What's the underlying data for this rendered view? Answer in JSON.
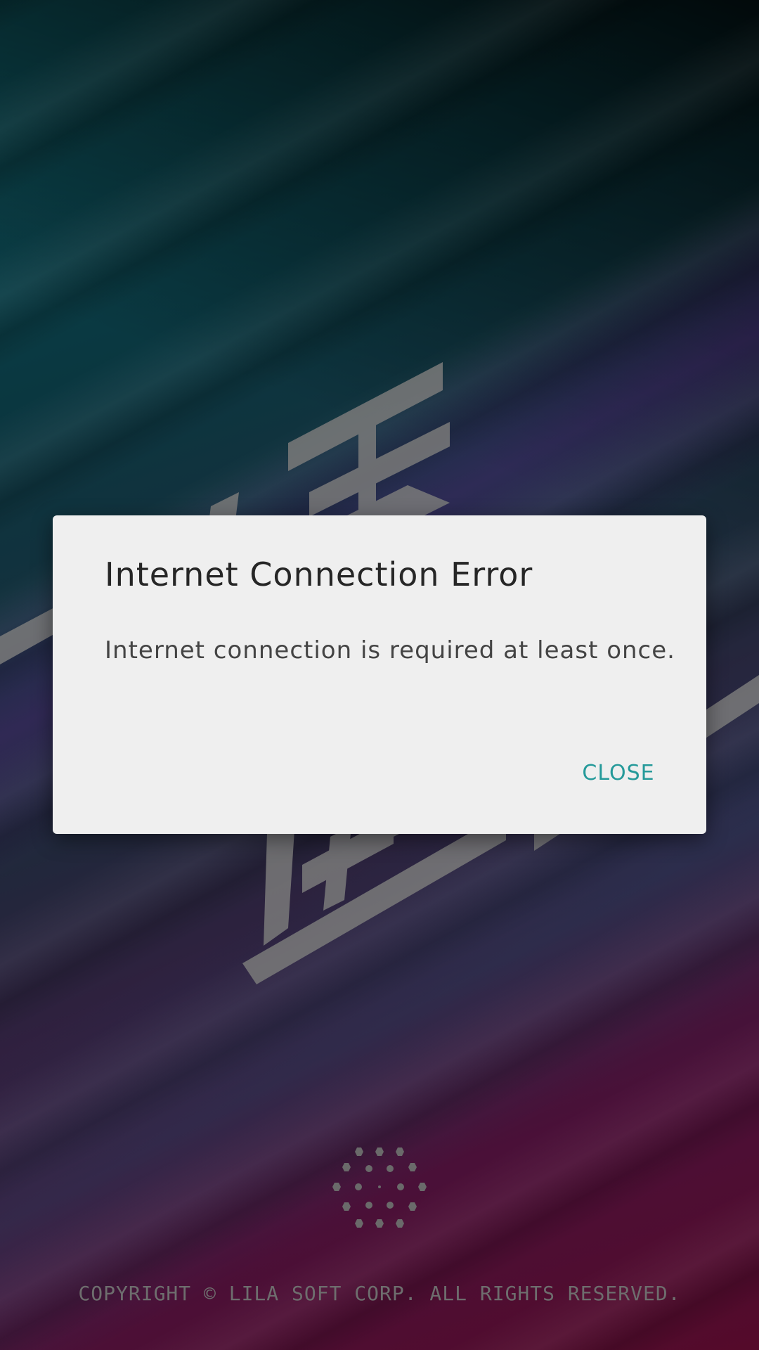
{
  "dialog": {
    "title": "Internet Connection Error",
    "message": "Internet connection is required at least once.",
    "close_label": "CLOSE",
    "accent_color": "#259a9a"
  },
  "footer": {
    "copyright": "COPYRIGHT © LILA SOFT CORP. ALL RIGHTS RESERVED."
  },
  "icons": {
    "background_logo": "stylized-logo-glyphs",
    "loading_indicator": "hexagon-dot-spinner"
  }
}
